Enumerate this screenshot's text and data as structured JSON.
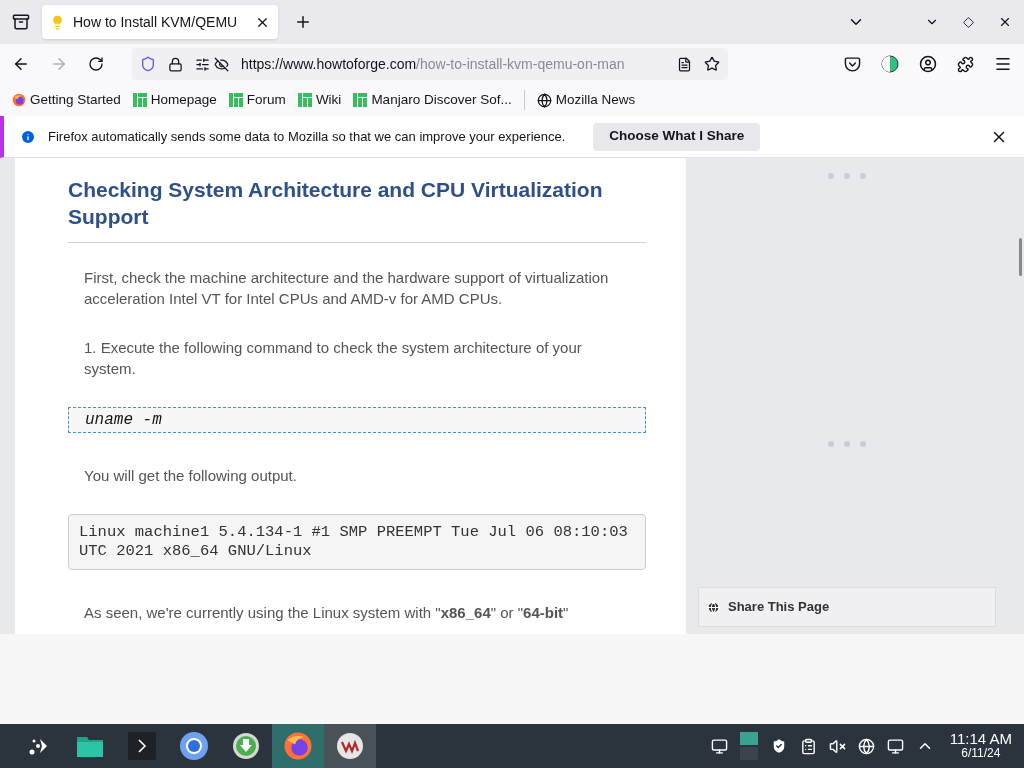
{
  "tabs": [
    {
      "title": "How to Install KVM/QEMU",
      "selected": true
    }
  ],
  "address": {
    "host": "https://www.howtoforge.com",
    "path": "/how-to-install-kvm-qemu-on-man"
  },
  "bookmarks": [
    {
      "label": "Getting Started",
      "kind": "firefox"
    },
    {
      "label": "Homepage",
      "kind": "manjaro"
    },
    {
      "label": "Forum",
      "kind": "manjaro"
    },
    {
      "label": "Wiki",
      "kind": "manjaro"
    },
    {
      "label": "Manjaro Discover Sof...",
      "kind": "manjaro"
    },
    {
      "label": "Mozilla News",
      "kind": "globe"
    }
  ],
  "notification": {
    "message": "Firefox automatically sends some data to Mozilla so that we can improve your experience.",
    "button": "Choose What I Share"
  },
  "article": {
    "heading": "Checking System Architecture and CPU Virtualization Support",
    "blocks": [
      {
        "kind": "text",
        "text": "First, check the machine architecture and the hardware support of virtualization acceleration Intel VT for Intel CPUs and AMD-v for AMD CPUs."
      },
      {
        "kind": "text",
        "text": "1. Execute the following command to check the system architecture of your system."
      },
      {
        "kind": "command",
        "text": "uname -m"
      },
      {
        "kind": "text",
        "text": "You will get the following output."
      },
      {
        "kind": "output",
        "text": "Linux machine1 5.4.134-1 #1 SMP PREEMPT Tue Jul 06 08:10:03 UTC 2021 x86_64 GNU/Linux"
      },
      {
        "kind": "text",
        "text": "As seen, we're currently using the Linux system with \"**x86_64**\" or \"**64-bit**\""
      }
    ]
  },
  "sidebar": {
    "share_title": "Share This Page"
  },
  "taskbar": {
    "apps": [
      {
        "kind": "launcher",
        "selected": false,
        "hovered": false
      },
      {
        "kind": "files",
        "selected": false,
        "hovered": false
      },
      {
        "kind": "terminal",
        "selected": false,
        "hovered": false
      },
      {
        "kind": "chromium",
        "selected": false,
        "hovered": false
      },
      {
        "kind": "download",
        "selected": false,
        "hovered": false
      },
      {
        "kind": "firefox",
        "selected": true,
        "hovered": false
      },
      {
        "kind": "vm",
        "selected": false,
        "hovered": true
      }
    ],
    "time": "11:14 AM",
    "date": "6/11/24"
  }
}
